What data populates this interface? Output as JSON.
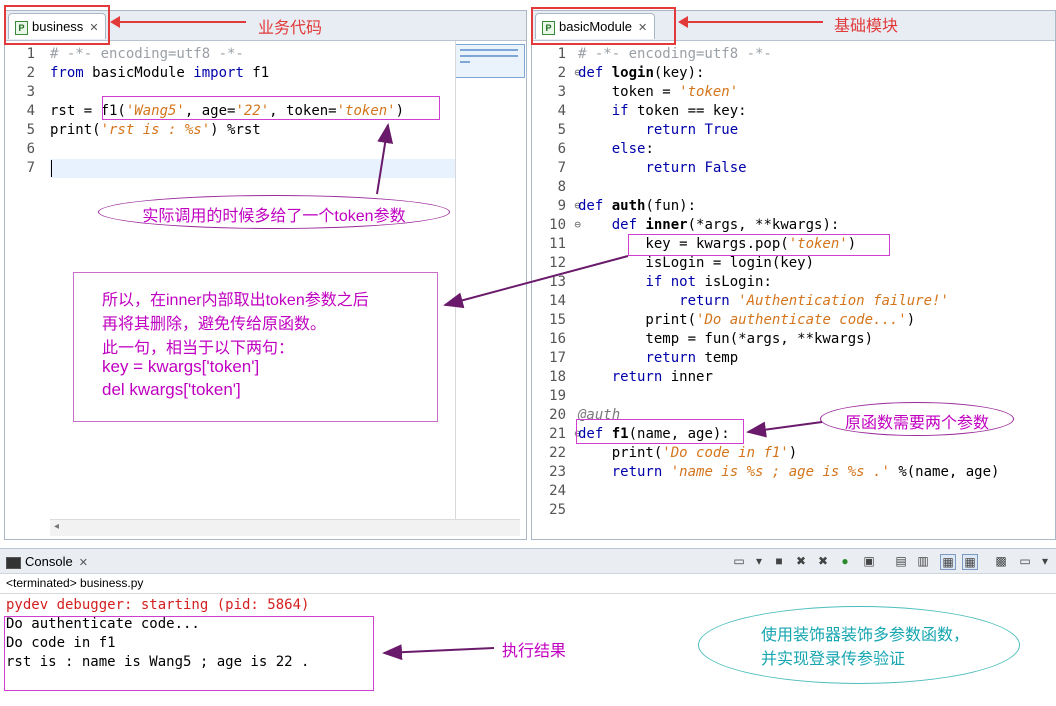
{
  "left_editor": {
    "tab_label": "business",
    "annotation_tab": "业务代码",
    "lines": [
      {
        "n": "1",
        "segs": [
          {
            "t": "# -*- encoding=utf8 -*-",
            "c": "cm"
          }
        ]
      },
      {
        "n": "2",
        "segs": [
          {
            "t": "from",
            "c": "kw"
          },
          {
            "t": " basicModule "
          },
          {
            "t": "import",
            "c": "kw"
          },
          {
            "t": " f1"
          }
        ]
      },
      {
        "n": "3",
        "segs": []
      },
      {
        "n": "4",
        "segs": [
          {
            "t": "rst = f1("
          },
          {
            "t": "'Wang5'",
            "c": "st"
          },
          {
            "t": ", age="
          },
          {
            "t": "'22'",
            "c": "st"
          },
          {
            "t": ", token="
          },
          {
            "t": "'token'",
            "c": "st"
          },
          {
            "t": ")"
          }
        ]
      },
      {
        "n": "5",
        "segs": [
          {
            "t": "print("
          },
          {
            "t": "'rst is : %s'",
            "c": "st"
          },
          {
            "t": ") %rst"
          }
        ]
      },
      {
        "n": "6",
        "segs": []
      },
      {
        "n": "7",
        "segs": []
      }
    ],
    "callout_token": "实际调用的时候多给了一个token参数",
    "callout_explain": [
      "所以，在inner内部取出token参数之后",
      "再将其删除，避免传给原函数。",
      "此一句，相当于以下两句：",
      "key = kwargs['token']",
      "del kwargs['token']"
    ]
  },
  "right_editor": {
    "tab_label": "basicModule",
    "annotation_tab": "基础模块",
    "lines": [
      {
        "n": "1",
        "segs": [
          {
            "t": "# -*- encoding=utf8 -*-",
            "c": "cm"
          }
        ]
      },
      {
        "n": "2",
        "fold": true,
        "segs": [
          {
            "t": "def",
            "c": "kw"
          },
          {
            "t": " "
          },
          {
            "t": "login",
            "c": "bold"
          },
          {
            "t": "(key):"
          }
        ]
      },
      {
        "n": "3",
        "segs": [
          {
            "t": "    token = "
          },
          {
            "t": "'token'",
            "c": "st"
          }
        ]
      },
      {
        "n": "4",
        "segs": [
          {
            "t": "    "
          },
          {
            "t": "if",
            "c": "kw"
          },
          {
            "t": " token == key:"
          }
        ]
      },
      {
        "n": "5",
        "segs": [
          {
            "t": "        "
          },
          {
            "t": "return",
            "c": "kw"
          },
          {
            "t": " "
          },
          {
            "t": "True",
            "c": "kw"
          }
        ]
      },
      {
        "n": "6",
        "segs": [
          {
            "t": "    "
          },
          {
            "t": "else",
            "c": "kw"
          },
          {
            "t": ":"
          }
        ]
      },
      {
        "n": "7",
        "segs": [
          {
            "t": "        "
          },
          {
            "t": "return",
            "c": "kw"
          },
          {
            "t": " "
          },
          {
            "t": "False",
            "c": "kw"
          }
        ]
      },
      {
        "n": "8",
        "segs": []
      },
      {
        "n": "9",
        "fold": true,
        "segs": [
          {
            "t": "def",
            "c": "kw"
          },
          {
            "t": " "
          },
          {
            "t": "auth",
            "c": "bold"
          },
          {
            "t": "(fun):"
          }
        ]
      },
      {
        "n": "10",
        "fold": true,
        "segs": [
          {
            "t": "    "
          },
          {
            "t": "def",
            "c": "kw"
          },
          {
            "t": " "
          },
          {
            "t": "inner",
            "c": "bold"
          },
          {
            "t": "(*args, **kwargs):"
          }
        ]
      },
      {
        "n": "11",
        "segs": [
          {
            "t": "        key = kwargs.pop("
          },
          {
            "t": "'token'",
            "c": "st"
          },
          {
            "t": ")"
          }
        ]
      },
      {
        "n": "12",
        "segs": [
          {
            "t": "        isLogin = login(key)"
          }
        ]
      },
      {
        "n": "13",
        "segs": [
          {
            "t": "        "
          },
          {
            "t": "if not",
            "c": "kw"
          },
          {
            "t": " isLogin:"
          }
        ]
      },
      {
        "n": "14",
        "segs": [
          {
            "t": "            "
          },
          {
            "t": "return",
            "c": "kw"
          },
          {
            "t": " "
          },
          {
            "t": "'Authentication failure!'",
            "c": "st"
          }
        ]
      },
      {
        "n": "15",
        "segs": [
          {
            "t": "        print("
          },
          {
            "t": "'Do authenticate code...'",
            "c": "st"
          },
          {
            "t": ")"
          }
        ]
      },
      {
        "n": "16",
        "segs": [
          {
            "t": "        temp = fun(*args, **kwargs)"
          }
        ]
      },
      {
        "n": "17",
        "segs": [
          {
            "t": "        "
          },
          {
            "t": "return",
            "c": "kw"
          },
          {
            "t": " temp"
          }
        ]
      },
      {
        "n": "18",
        "segs": [
          {
            "t": "    "
          },
          {
            "t": "return",
            "c": "kw"
          },
          {
            "t": " inner"
          }
        ]
      },
      {
        "n": "19",
        "segs": []
      },
      {
        "n": "20",
        "segs": [
          {
            "t": "@auth",
            "c": "dec"
          }
        ]
      },
      {
        "n": "21",
        "fold": true,
        "segs": [
          {
            "t": "def",
            "c": "kw"
          },
          {
            "t": " "
          },
          {
            "t": "f1",
            "c": "bold"
          },
          {
            "t": "(name, age):"
          }
        ]
      },
      {
        "n": "22",
        "segs": [
          {
            "t": "    print("
          },
          {
            "t": "'Do code in f1'",
            "c": "st"
          },
          {
            "t": ")"
          }
        ]
      },
      {
        "n": "23",
        "segs": [
          {
            "t": "    "
          },
          {
            "t": "return",
            "c": "kw"
          },
          {
            "t": " "
          },
          {
            "t": "'name is %s ; age is %s .'",
            "c": "st"
          },
          {
            "t": " %(name, age)"
          }
        ]
      },
      {
        "n": "24",
        "segs": []
      },
      {
        "n": "25",
        "segs": []
      }
    ],
    "callout_params": "原函数需要两个参数"
  },
  "console": {
    "tab_label": "Console",
    "status": "<terminated> business.py",
    "debug_line": "pydev debugger: starting (pid: 5864)",
    "output": [
      "Do authenticate code...",
      "Do code in f1",
      "rst is : name is Wang5 ; age is 22 ."
    ],
    "annotation_result": "执行结果",
    "note": [
      "使用装饰器装饰多参数函数，",
      "并实现登录传参验证"
    ]
  }
}
